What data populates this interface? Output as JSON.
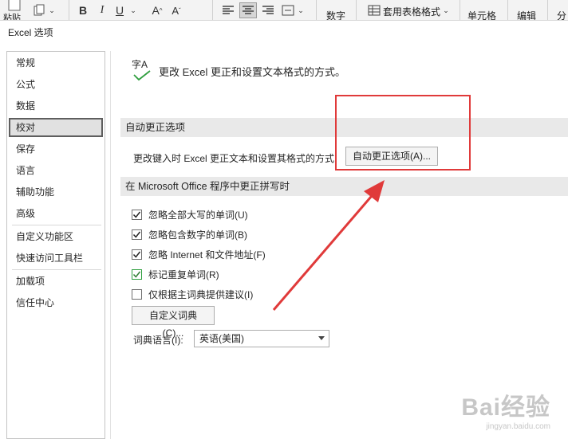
{
  "ribbon": {
    "paste_label": "粘贴",
    "bold": "B",
    "italic": "I",
    "underline": "U",
    "number_label": "数字",
    "table_format_label": "套用表格格式",
    "cell_label": "单元格",
    "edit_label": "编辑",
    "analyze_label": "分"
  },
  "dialog": {
    "title": "Excel 选项"
  },
  "sidebar": {
    "items": [
      "常规",
      "公式",
      "数据",
      "校对",
      "保存",
      "语言",
      "辅助功能",
      "高级",
      "自定义功能区",
      "快速访问工具栏",
      "加载项",
      "信任中心"
    ],
    "selected": "校对"
  },
  "header": {
    "icon_text": "字A",
    "text": "更改 Excel 更正和设置文本格式的方式。"
  },
  "autocorrect": {
    "section_title": "自动更正选项",
    "description": "更改键入时 Excel 更正文本和设置其格式的方式",
    "button_label": "自动更正选项(A)..."
  },
  "spelling": {
    "section_title": "在 Microsoft Office 程序中更正拼写时",
    "checkboxes": [
      {
        "label": "忽略全部大写的单词(U)",
        "checked": true
      },
      {
        "label": "忽略包含数字的单词(B)",
        "checked": true
      },
      {
        "label": "忽略 Internet 和文件地址(F)",
        "checked": true
      },
      {
        "label": "标记重复单词(R)",
        "checked": true
      },
      {
        "label": "仅根据主词典提供建议(I)",
        "checked": false
      }
    ],
    "custom_dict_button": "自定义词典(C)...",
    "dict_lang_label": "词典语言(I):",
    "dict_lang_value": "英语(美国)"
  },
  "watermark": {
    "logo": "Bai经验",
    "url": "jingyan.baidu.com"
  },
  "colors": {
    "annotation_red": "#e03a3a",
    "check_green": "#2e9e3e"
  }
}
